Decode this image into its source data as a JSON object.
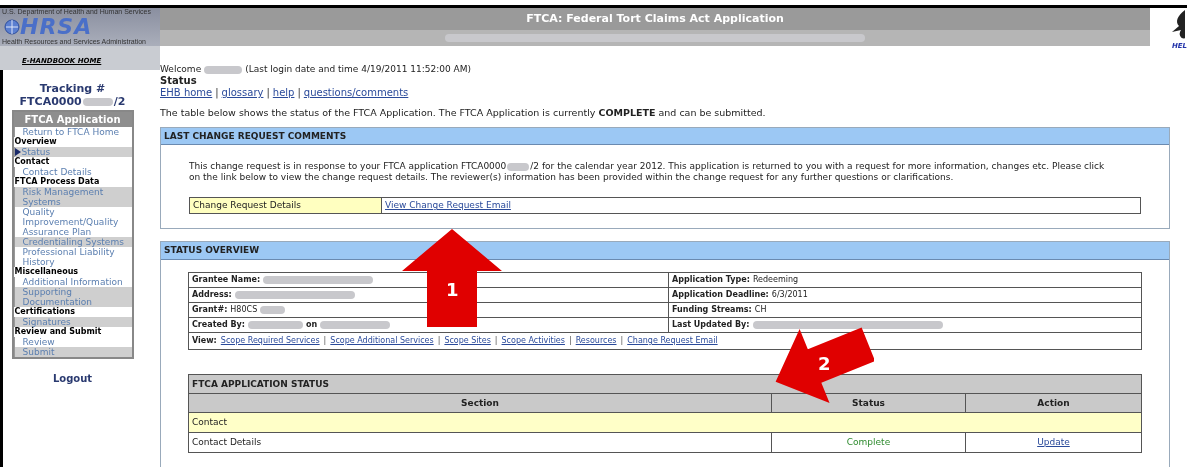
{
  "header": {
    "agency": "U.S. Department of Health and Human Services",
    "logo": "HRSA",
    "agency_sub": "Health Resources and Services Administration",
    "home_link": "E-HANDBOOK HOME",
    "title": "FTCA: Federal Tort Claims Act Application",
    "help": "HEL"
  },
  "sidebar": {
    "tracking_label": "Tracking #",
    "tracking_prefix": "FTCA0000",
    "tracking_suffix": "/2",
    "menu_title": "FTCA Application",
    "items": [
      {
        "kind": "link",
        "label": "Return to FTCA Home",
        "selected": false,
        "shaded": false
      },
      {
        "kind": "heading",
        "label": "Overview"
      },
      {
        "kind": "link",
        "label": "Status",
        "selected": true,
        "shaded": true
      },
      {
        "kind": "heading",
        "label": "Contact"
      },
      {
        "kind": "link",
        "label": "Contact Details",
        "selected": false,
        "shaded": false
      },
      {
        "kind": "heading",
        "label": "FTCA Process Data"
      },
      {
        "kind": "link",
        "label": "Risk Management Systems",
        "selected": false,
        "shaded": true
      },
      {
        "kind": "link",
        "label": "Quality Improvement/Quality Assurance Plan",
        "selected": false,
        "shaded": false
      },
      {
        "kind": "link",
        "label": "Credentialing Systems",
        "selected": false,
        "shaded": true
      },
      {
        "kind": "link",
        "label": "Professional Liability History",
        "selected": false,
        "shaded": false
      },
      {
        "kind": "heading",
        "label": "Miscellaneous"
      },
      {
        "kind": "link",
        "label": "Additional Information",
        "selected": false,
        "shaded": false
      },
      {
        "kind": "link",
        "label": "Supporting Documentation",
        "selected": false,
        "shaded": true
      },
      {
        "kind": "heading",
        "label": "Certifications"
      },
      {
        "kind": "link",
        "label": "Signatures",
        "selected": false,
        "shaded": true
      },
      {
        "kind": "heading",
        "label": "Review and Submit"
      },
      {
        "kind": "link",
        "label": "Review",
        "selected": false,
        "shaded": false
      },
      {
        "kind": "link",
        "label": "Submit",
        "selected": false,
        "shaded": true
      }
    ],
    "logout": "Logout"
  },
  "main": {
    "welcome_prefix": "Welcome",
    "welcome_suffix": "(Last login date and time 4/19/2011 11:52:00 AM)",
    "page_title": "Status",
    "links": [
      "EHB home",
      "glossary",
      "help",
      "questions/comments"
    ],
    "link_separators": [
      "|",
      "|",
      "|"
    ],
    "intro": "The table below shows the status of the FTCA Application. The FTCA Application is currently **COMPLETE** and can be submitted.",
    "change_request": {
      "title": "LAST CHANGE REQUEST COMMENTS",
      "text_before": "This change request is in response to your FTCA application FTCA0000",
      "text_after": "/2 for the calendar year 2012. This application is returned to you with a request for more information, changes etc. Please click on the link below to view the change request details. The reviewer(s) information has been provided within the change request for any further questions or clarifications.",
      "details_label": "Change Request Details",
      "details_link": "View Change Request Email"
    },
    "status_overview": {
      "title": "STATUS OVERVIEW",
      "left": [
        {
          "label": "Grantee Name:"
        },
        {
          "label": "Address:"
        },
        {
          "label": "Grant#:",
          "value": "H80CS"
        },
        {
          "label": "Created By:",
          "value": "on"
        }
      ],
      "right": [
        {
          "label": "Application Type:",
          "value": "Redeeming"
        },
        {
          "label": "Application Deadline:",
          "value": "6/3/2011"
        },
        {
          "label": "Funding Streams:",
          "value": "CH"
        },
        {
          "label": "Last Updated By:"
        }
      ],
      "view_label": "View:",
      "view_links": [
        "Scope Required Services",
        "Scope Additional Services",
        "Scope Sites",
        "Scope Activities",
        "Resources",
        "Change Request Email"
      ],
      "view_separators": [
        "|",
        "|",
        "|",
        "|",
        "|"
      ]
    },
    "app_status": {
      "title": "FTCA APPLICATION STATUS",
      "columns": [
        "Section",
        "Status",
        "Action"
      ],
      "rows": [
        {
          "kind": "group",
          "section": "Contact"
        },
        {
          "kind": "item",
          "section": "Contact Details",
          "status": "Complete",
          "action": "Update"
        }
      ]
    }
  },
  "annotations": [
    {
      "label": "1",
      "kind": "up-arrow"
    },
    {
      "label": "2",
      "kind": "left-arrow"
    }
  ]
}
